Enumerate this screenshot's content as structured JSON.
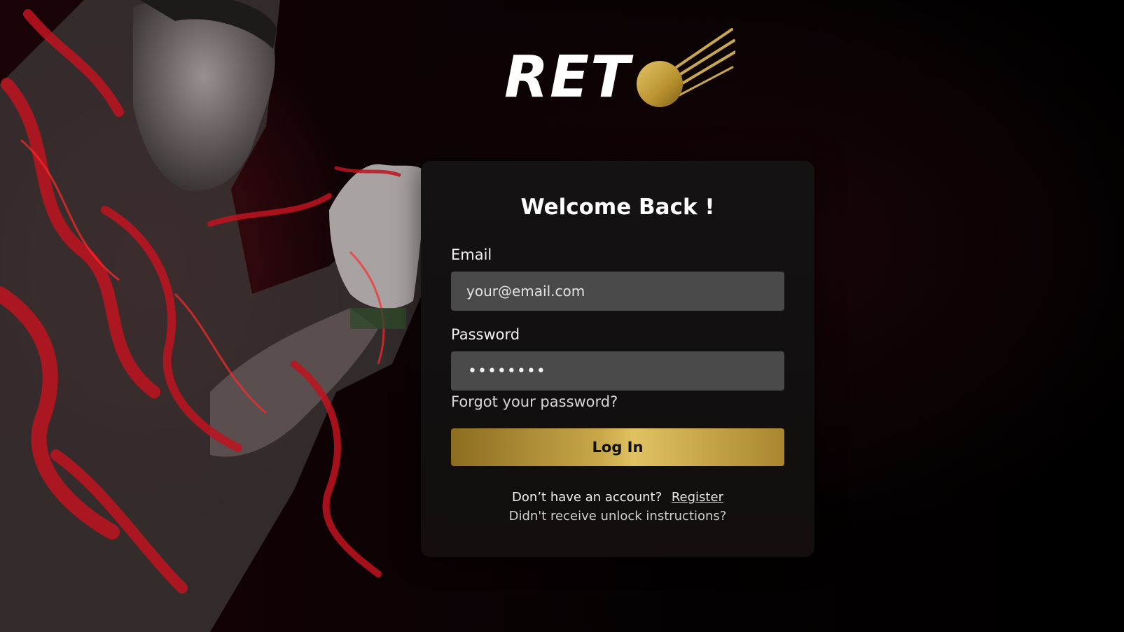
{
  "brand": {
    "logo_text": "RET",
    "logo_icon": "golden-ball-icon",
    "gold": "#c9a84a"
  },
  "login": {
    "title": "Welcome Back !",
    "email_label": "Email",
    "email_placeholder": "your@email.com",
    "password_label": "Password",
    "password_value": "••••••••",
    "forgot_link": "Forgot your password?",
    "login_button": "Log In",
    "no_account_text": "Don’t have an account?",
    "register_link": "Register",
    "unlock_link": "Didn't receive unlock instructions?"
  },
  "colors": {
    "background": "#000000",
    "card": "#121010",
    "input": "#4a4a4a",
    "accent": "#c9a84a"
  }
}
